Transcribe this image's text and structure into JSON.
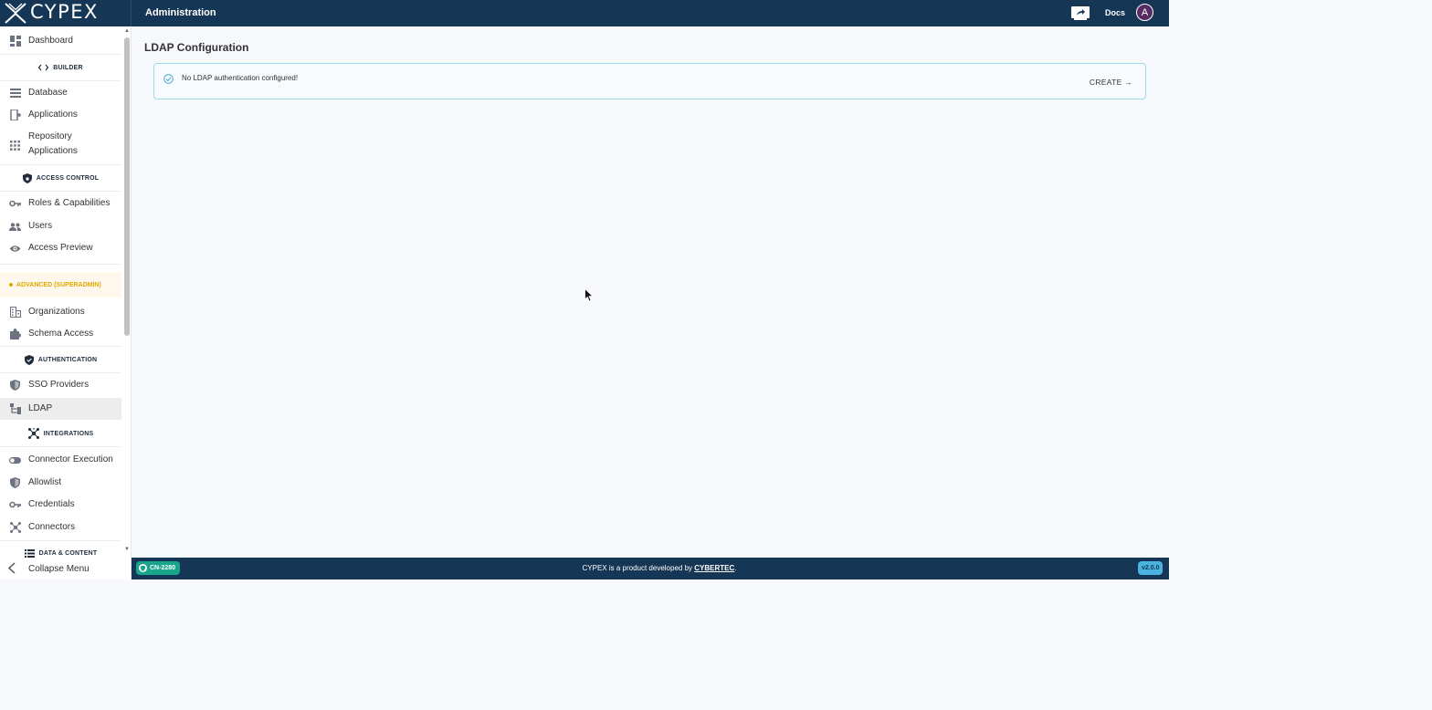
{
  "header": {
    "logo_text": "CYPEX",
    "title": "Administration",
    "docs_label": "Docs",
    "avatar_initial": "A"
  },
  "sidebar": {
    "dashboard": "Dashboard",
    "builder_head": "BUILDER",
    "database": "Database",
    "applications": "Applications",
    "repository_applications_line1": "Repository",
    "repository_applications_line2": "Applications",
    "access_control_head": "ACCESS CONTROL",
    "roles": "Roles & Capabilities",
    "users": "Users",
    "access_preview": "Access Preview",
    "advanced_head": "ADVANCED (SUPERADMIN)",
    "organizations": "Organizations",
    "schema_access": "Schema Access",
    "authentication_head": "AUTHENTICATION",
    "sso_providers": "SSO Providers",
    "ldap": "LDAP",
    "integrations_head": "INTEGRATIONS",
    "connector_execution": "Connector Execution",
    "allowlist": "Allowlist",
    "credentials": "Credentials",
    "connectors": "Connectors",
    "data_content_head": "DATA & CONTENT",
    "collapse_menu": "Collapse Menu"
  },
  "main": {
    "page_title": "LDAP Configuration",
    "alert_text": "No LDAP authentication configured!",
    "create_label": "CREATE →"
  },
  "footer": {
    "build_tag": "CN-2280",
    "product_text": "CYPEX is a product developed by",
    "company": "CYBERTEC",
    "period": ".",
    "version": "v2.0.0"
  },
  "colors": {
    "header_bg": "#163655",
    "accent_teal": "#18a58c",
    "advanced_yellow": "#e0a800",
    "version_blue": "#4ab3e0"
  }
}
